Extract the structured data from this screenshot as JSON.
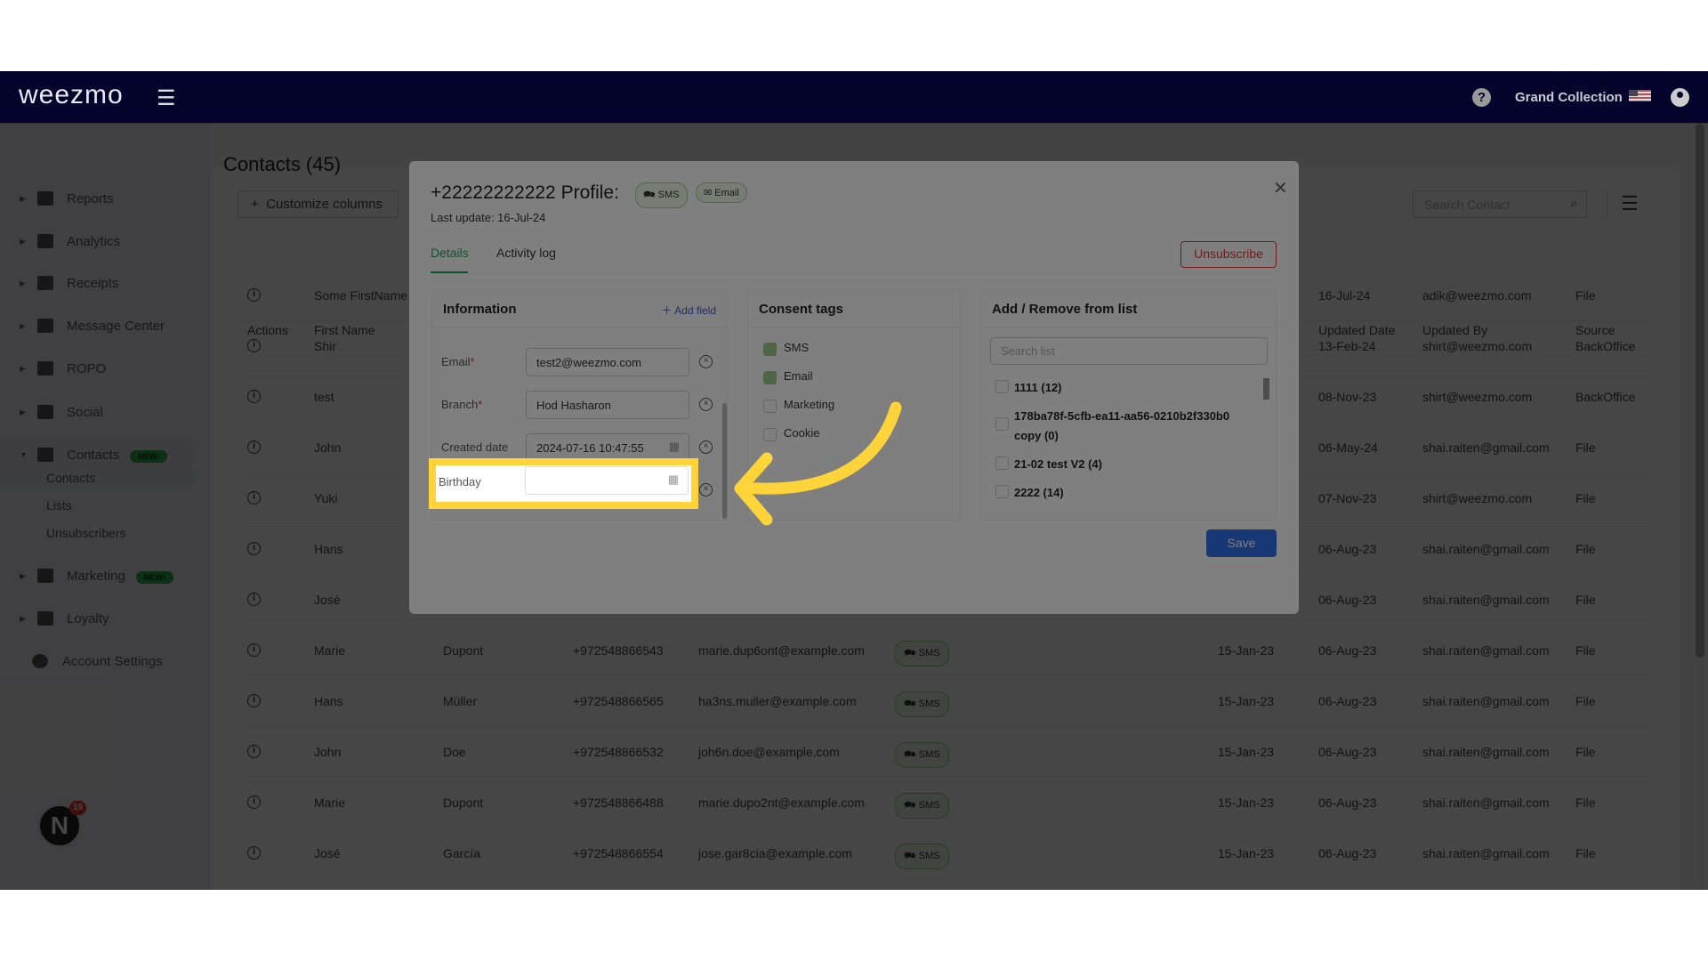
{
  "navbar": {
    "logo": "weezmo",
    "account": "Grand Collection",
    "icons": [
      "menu-icon",
      "help-icon",
      "us-flag-icon",
      "user-icon"
    ]
  },
  "sidebar": {
    "items": [
      {
        "label": "Reports",
        "icon": "dashboard-icon"
      },
      {
        "label": "Analytics",
        "icon": "analytics-icon"
      },
      {
        "label": "Receipts",
        "icon": "receipt-icon"
      },
      {
        "label": "Message Center",
        "icon": "chat-icon"
      },
      {
        "label": "ROPO",
        "icon": "infinity-icon"
      },
      {
        "label": "Social",
        "icon": "people-icon"
      },
      {
        "label": "Contacts",
        "icon": "contacts-icon",
        "badge": "NEW!"
      }
    ],
    "contacts_sub": [
      "Contacts",
      "Lists",
      "Unsubscribers"
    ],
    "items2": [
      {
        "label": "Marketing",
        "icon": "megaphone-icon",
        "badge": "NEW!"
      },
      {
        "label": "Loyalty",
        "icon": "tag-icon"
      },
      {
        "label": "Account Settings",
        "icon": "gear-icon"
      }
    ],
    "notification_count": "19"
  },
  "page": {
    "title": "Contacts (45)",
    "customize": "Customize columns",
    "search_placeholder": "Search Contact"
  },
  "table": {
    "headers": {
      "actions": "Actions",
      "first": "First Name",
      "updated_date": "Updated Date",
      "updated_by": "Updated By",
      "source": "Source"
    },
    "rows": [
      {
        "first": "Some FirstName",
        "updated_date": "16-Jul-24",
        "updated_by": "adik@weezmo.com",
        "source": "File"
      },
      {
        "first": "Shir",
        "updated_date": "13-Feb-24",
        "updated_by": "shirt@weezmo.com",
        "source": "BackOffice"
      },
      {
        "first": "test",
        "updated_date": "08-Nov-23",
        "updated_by": "shirt@weezmo.com",
        "source": "BackOffice"
      },
      {
        "first": "John",
        "updated_date": "06-May-24",
        "updated_by": "shai.raiten@gmail.com",
        "source": "File"
      },
      {
        "first": "Yuki",
        "updated_date": "07-Nov-23",
        "updated_by": "shirt@weezmo.com",
        "source": "File"
      },
      {
        "first": "Hans",
        "updated_date": "06-Aug-23",
        "updated_by": "shai.raiten@gmail.com",
        "source": "File"
      },
      {
        "first": "José",
        "updated_date": "06-Aug-23",
        "updated_by": "shai.raiten@gmail.com",
        "source": "File"
      },
      {
        "first": "Marie",
        "last": "Dupont",
        "phone": "+972548866543",
        "email": "marie.dup6ont@example.com",
        "consent": "SMS",
        "created": "15-Jan-23",
        "updated_date": "06-Aug-23",
        "updated_by": "shai.raiten@gmail.com",
        "source": "File"
      },
      {
        "first": "Hans",
        "last": "Müller",
        "phone": "+972548866565",
        "email": "ha3ns.muller@example.com",
        "consent": "SMS",
        "created": "15-Jan-23",
        "updated_date": "06-Aug-23",
        "updated_by": "shai.raiten@gmail.com",
        "source": "File"
      },
      {
        "first": "John",
        "last": "Doe",
        "phone": "+972548866532",
        "email": "joh6n.doe@example.com",
        "consent": "SMS",
        "created": "15-Jan-23",
        "updated_date": "06-Aug-23",
        "updated_by": "shai.raiten@gmail.com",
        "source": "File"
      },
      {
        "first": "Marie",
        "last": "Dupont",
        "phone": "+972548866488",
        "email": "marie.dupo2nt@example.com",
        "consent": "SMS",
        "created": "15-Jan-23",
        "updated_date": "06-Aug-23",
        "updated_by": "shai.raiten@gmail.com",
        "source": "File"
      },
      {
        "first": "José",
        "last": "García",
        "phone": "+972548866554",
        "email": "jose.gar8cia@example.com",
        "consent": "SMS",
        "created": "15-Jan-23",
        "updated_date": "06-Aug-23",
        "updated_by": "shai.raiten@gmail.com",
        "source": "File"
      }
    ]
  },
  "modal": {
    "title": "+22222222222 Profile:",
    "badges": [
      "SMS",
      "Email"
    ],
    "last_update": "Last update: 16-Jul-24",
    "tabs": [
      "Details",
      "Activity log"
    ],
    "active_tab": "Details",
    "unsubscribe": "Unsubscribe",
    "save": "Save",
    "info": {
      "title": "Information",
      "add_field": "Add field",
      "fields": [
        {
          "label": "Email",
          "required": true,
          "value": "test2@weezmo.com"
        },
        {
          "label": "Branch",
          "required": true,
          "value": "Hod Hasharon"
        },
        {
          "label": "Created date",
          "value": "2024-07-16 10:47:55"
        },
        {
          "label": "Birthday",
          "value": ""
        }
      ]
    },
    "consent": {
      "title": "Consent tags",
      "tags": [
        {
          "label": "SMS",
          "checked": true
        },
        {
          "label": "Email",
          "checked": true
        },
        {
          "label": "Marketing",
          "checked": false
        },
        {
          "label": "Cookie",
          "checked": false
        }
      ]
    },
    "lists": {
      "title": "Add / Remove from list",
      "search_placeholder": "Search list",
      "items": [
        "1111 (12)",
        "178ba78f-5cfb-ea11-aa56-0210b2f330b0 copy (0)",
        "21-02 test V2 (4)",
        "2222 (14)"
      ]
    }
  },
  "colors": {
    "accent": "#1fa65a",
    "highlight": "#ffd43b",
    "save": "#2f6fea",
    "unsubscribe": "#e53935",
    "navbar": "#03032c"
  }
}
